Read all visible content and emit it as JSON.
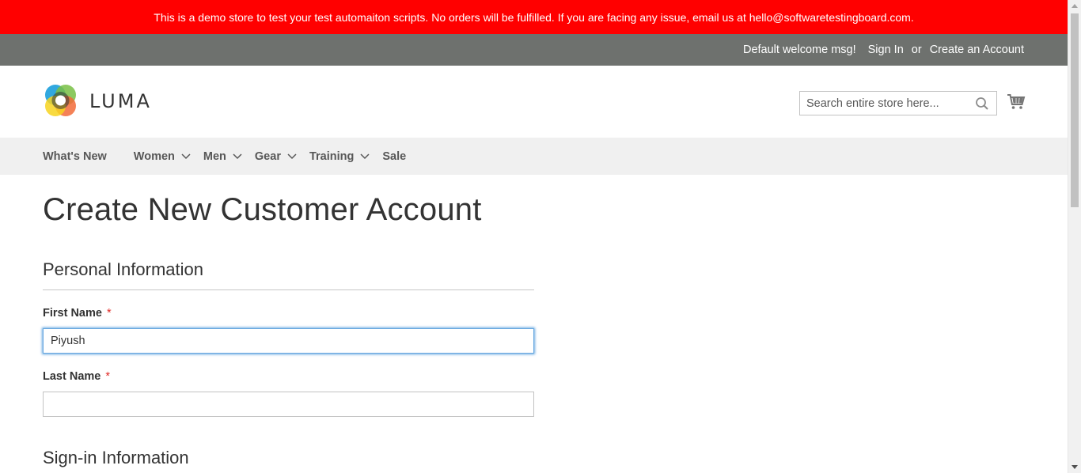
{
  "demo_notice": "This is a demo store to test your test automaiton scripts. No orders will be fulfilled. If you are facing any issue, email us at hello@softwaretestingboard.com.",
  "panel": {
    "welcome": "Default welcome msg!",
    "sign_in": "Sign In",
    "or": "or",
    "create_account": "Create an Account"
  },
  "header": {
    "logo_text": "LUMA",
    "search_placeholder": "Search entire store here...",
    "search_icon": "search-icon",
    "cart_icon": "cart-icon"
  },
  "nav": {
    "items": [
      {
        "label": "What's New",
        "has_dropdown": false
      },
      {
        "label": "Women",
        "has_dropdown": true
      },
      {
        "label": "Men",
        "has_dropdown": true
      },
      {
        "label": "Gear",
        "has_dropdown": true
      },
      {
        "label": "Training",
        "has_dropdown": true
      },
      {
        "label": "Sale",
        "has_dropdown": false
      }
    ]
  },
  "page": {
    "title": "Create New Customer Account",
    "section_personal": "Personal Information",
    "first_name_label": "First Name",
    "first_name_value": "Piyush",
    "last_name_label": "Last Name",
    "last_name_value": "",
    "required_mark": "*",
    "section_signin": "Sign-in Information"
  },
  "colors": {
    "demo_bar": "#ff0000",
    "panel_bar": "#6e716e",
    "nav_bar": "#f0f0f0",
    "focus_border": "#68a8e0",
    "required": "#e02b27"
  }
}
